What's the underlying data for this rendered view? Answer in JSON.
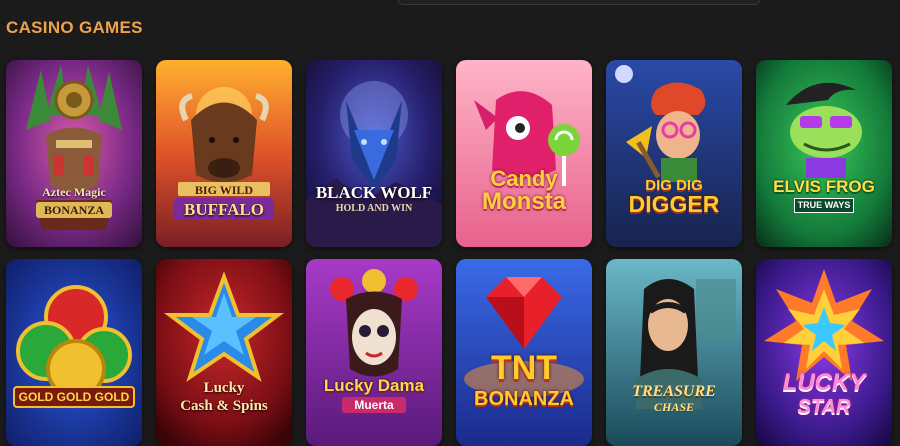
{
  "section": {
    "title": "CASINO GAMES"
  },
  "games": [
    {
      "name": "Aztec Magic",
      "sub": "BONANZA"
    },
    {
      "name": "BIG WILD",
      "sub": "BUFFALO"
    },
    {
      "name": "BLACK WOLF",
      "sub": "HOLD AND WIN"
    },
    {
      "name": "Candy",
      "sub": "Monsta"
    },
    {
      "name": "DIG DIG",
      "sub": "DIGGER"
    },
    {
      "name": "ELVIS FROG",
      "sub": "TRUE WAYS"
    },
    {
      "name": "GOLD GOLD GOLD",
      "sub": ""
    },
    {
      "name": "Lucky",
      "sub": "Cash & Spins"
    },
    {
      "name": "Lucky Dama",
      "sub": "Muerta"
    },
    {
      "name": "TNT",
      "sub": "BONANZA"
    },
    {
      "name": "TREASURE",
      "sub": "CHASE"
    },
    {
      "name": "LUCKY",
      "sub": "STAR"
    }
  ]
}
